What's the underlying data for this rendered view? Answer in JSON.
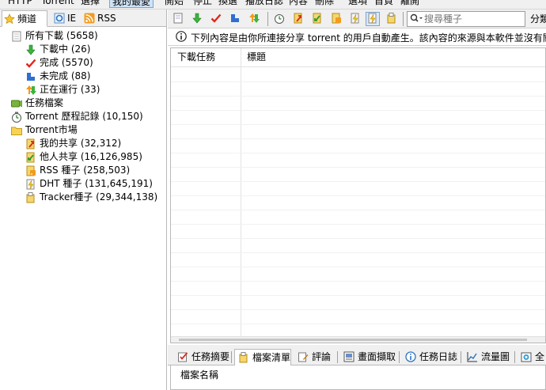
{
  "menu": {
    "items": [
      "HTTP",
      "Torrent",
      "選擇",
      "我的最愛",
      "開始",
      "停止",
      "換選",
      "播放日誌",
      "內容",
      "刪除",
      "選項",
      "首頁",
      "離開"
    ],
    "active_index": 3
  },
  "sidebar": {
    "tabs": [
      {
        "label": "頻道",
        "icon": "star-icon"
      },
      {
        "label": "IE",
        "icon": "ie-icon"
      },
      {
        "label": "RSS",
        "icon": "rss-icon"
      }
    ],
    "items": [
      {
        "label": "所有下載 (5658)",
        "icon": "all-downloads-icon",
        "level": 0
      },
      {
        "label": "下載中 (26)",
        "icon": "downloading-arrow-icon",
        "level": 1
      },
      {
        "label": "完成 (5570)",
        "icon": "completed-check-icon",
        "level": 1
      },
      {
        "label": "未完成 (88)",
        "icon": "unfinished-icon",
        "level": 1
      },
      {
        "label": "正在運行 (33)",
        "icon": "running-updown-icon",
        "level": 1
      },
      {
        "label": "任務檔案",
        "icon": "task-file-icon",
        "level": 0
      },
      {
        "label": "Torrent 歷程記錄 (10,150)",
        "icon": "history-icon",
        "level": 0
      },
      {
        "label": "Torrent市場",
        "icon": "market-folder-icon",
        "level": 0
      },
      {
        "label": "我的共享 (32,312)",
        "icon": "my-share-icon",
        "level": 1
      },
      {
        "label": "他人共享 (16,126,985)",
        "icon": "others-share-icon",
        "level": 1
      },
      {
        "label": "RSS 種子 (258,503)",
        "icon": "rss-seed-icon",
        "level": 1
      },
      {
        "label": "DHT 種子 (131,645,191)",
        "icon": "dht-seed-icon",
        "level": 1
      },
      {
        "label": "Tracker種子 (29,344,138)",
        "icon": "tracker-seed-icon",
        "level": 1
      }
    ]
  },
  "toolbar": {
    "search_placeholder": "搜尋種子",
    "category_label": "分類"
  },
  "notice": {
    "text": "下列內容是由你所連接分享 torrent 的用戶自動產生。該內容的來源與本軟件並沒有關係"
  },
  "list": {
    "columns": [
      "下載任務",
      "標題"
    ]
  },
  "bottom_tabs": [
    {
      "label": "任務摘要",
      "icon": "summary-icon"
    },
    {
      "label": "檔案清單",
      "icon": "file-list-icon"
    },
    {
      "label": "評論",
      "icon": "comment-icon"
    },
    {
      "label": "畫面擷取",
      "icon": "screenshot-icon"
    },
    {
      "label": "任務日誌",
      "icon": "task-log-icon"
    },
    {
      "label": "流量圖",
      "icon": "traffic-chart-icon"
    },
    {
      "label": "全",
      "icon": "all-icon"
    }
  ],
  "bottom_panel": {
    "column": "檔案名稱"
  }
}
